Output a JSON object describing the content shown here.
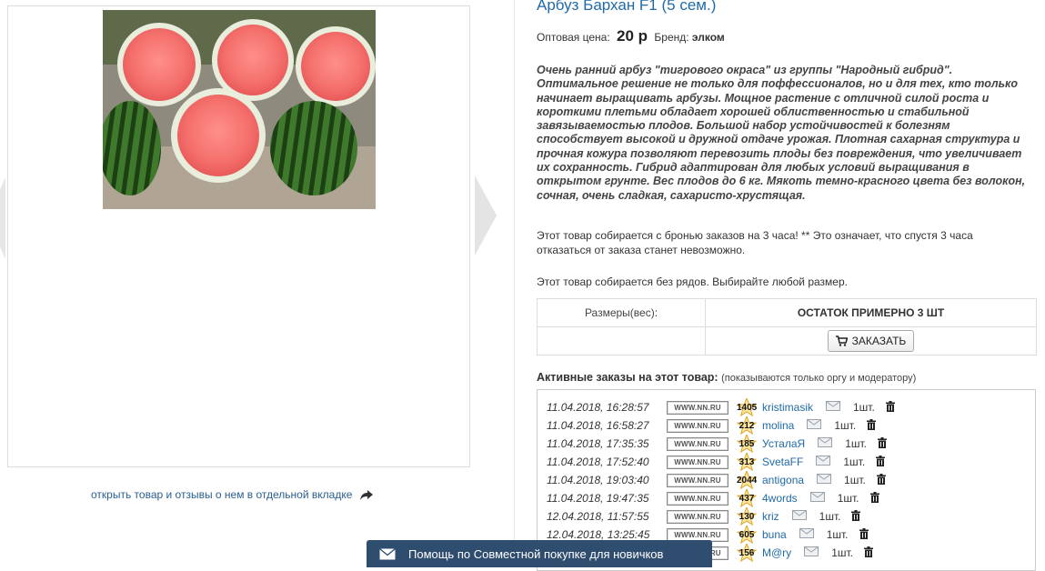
{
  "product": {
    "title": "Арбуз Бархан F1 (5 сем.)",
    "price_label": "Оптовая цена:",
    "price_value": "20 р",
    "brand_label": "Бренд:",
    "brand_value": "элком",
    "description": "Очень ранний арбуз \"тигрового окраса\" из группы \"Народный гибрид\". Оптимальное решение не только для поффессионалов, но и для тех, кто только начинает выращивать арбузы. Мощное растение с отличной силой роста и короткими плетьми обладает хорошей облиственностью и стабильной завязываемостью плодов. Большой набор устойчивостей к болезням способствует высокой и дружной отдаче урожая. Плотная сахарная структура и прочная кожура позволяют перевозить плоды без повреждения, что увеличивает их сохранность. Гибрид адаптирован для любых условий выращивания в открытом грунте. Вес плодов до 6 кг. Мякоть темно-красного цвета без волокон, сочная, очень сладкая, сахаристо-хрустящая.",
    "note_booking": "Этот товар собирается с бронью заказов на 3 часа! ** Это означает, что спустя 3 часа отказаться от заказа станет невозможно.",
    "note_sizes": "Этот товар собирается без рядов. Выбирайте любой размер."
  },
  "gallery": {
    "open_link": "открыть товар и отзывы о нем в отдельной вкладке"
  },
  "size_table": {
    "col_sizes": "Размеры(вес):",
    "col_stock": "ОСТАТОК ПРИМЕРНО 3 ШТ",
    "order_button": "ЗАКАЗАТЬ"
  },
  "orders": {
    "title": "Активные заказы на этот товар:",
    "subtitle": "(показываются только оргу и модератору)",
    "badge": "WWW.NN.RU",
    "rows": [
      {
        "date": "11.04.2018, 16:28:57",
        "rating": "1405",
        "user": "kristimasik",
        "qty": "1шт."
      },
      {
        "date": "11.04.2018, 16:58:27",
        "rating": "212",
        "user": "molina",
        "qty": "1шт."
      },
      {
        "date": "11.04.2018, 17:35:35",
        "rating": "185",
        "user": "УсталаЯ",
        "qty": "1шт."
      },
      {
        "date": "11.04.2018, 17:52:40",
        "rating": "313",
        "user": "SvetaFF",
        "qty": "1шт."
      },
      {
        "date": "11.04.2018, 19:03:40",
        "rating": "2044",
        "user": "antigona",
        "qty": "1шт."
      },
      {
        "date": "11.04.2018, 19:47:35",
        "rating": "437",
        "user": "4words",
        "qty": "1шт."
      },
      {
        "date": "12.04.2018, 11:57:55",
        "rating": "130",
        "user": "kriz",
        "qty": "1шт."
      },
      {
        "date": "12.04.2018, 13:25:45",
        "rating": "605",
        "user": "buna",
        "qty": "1шт."
      },
      {
        "date": "",
        "rating": "156",
        "user": "M@ry",
        "qty": "1шт."
      }
    ]
  },
  "help_bar": {
    "label": "Помощь по Совместной покупке для новичков"
  },
  "colors": {
    "link": "#1f6aa8",
    "help_bar": "#2f4d6e"
  }
}
